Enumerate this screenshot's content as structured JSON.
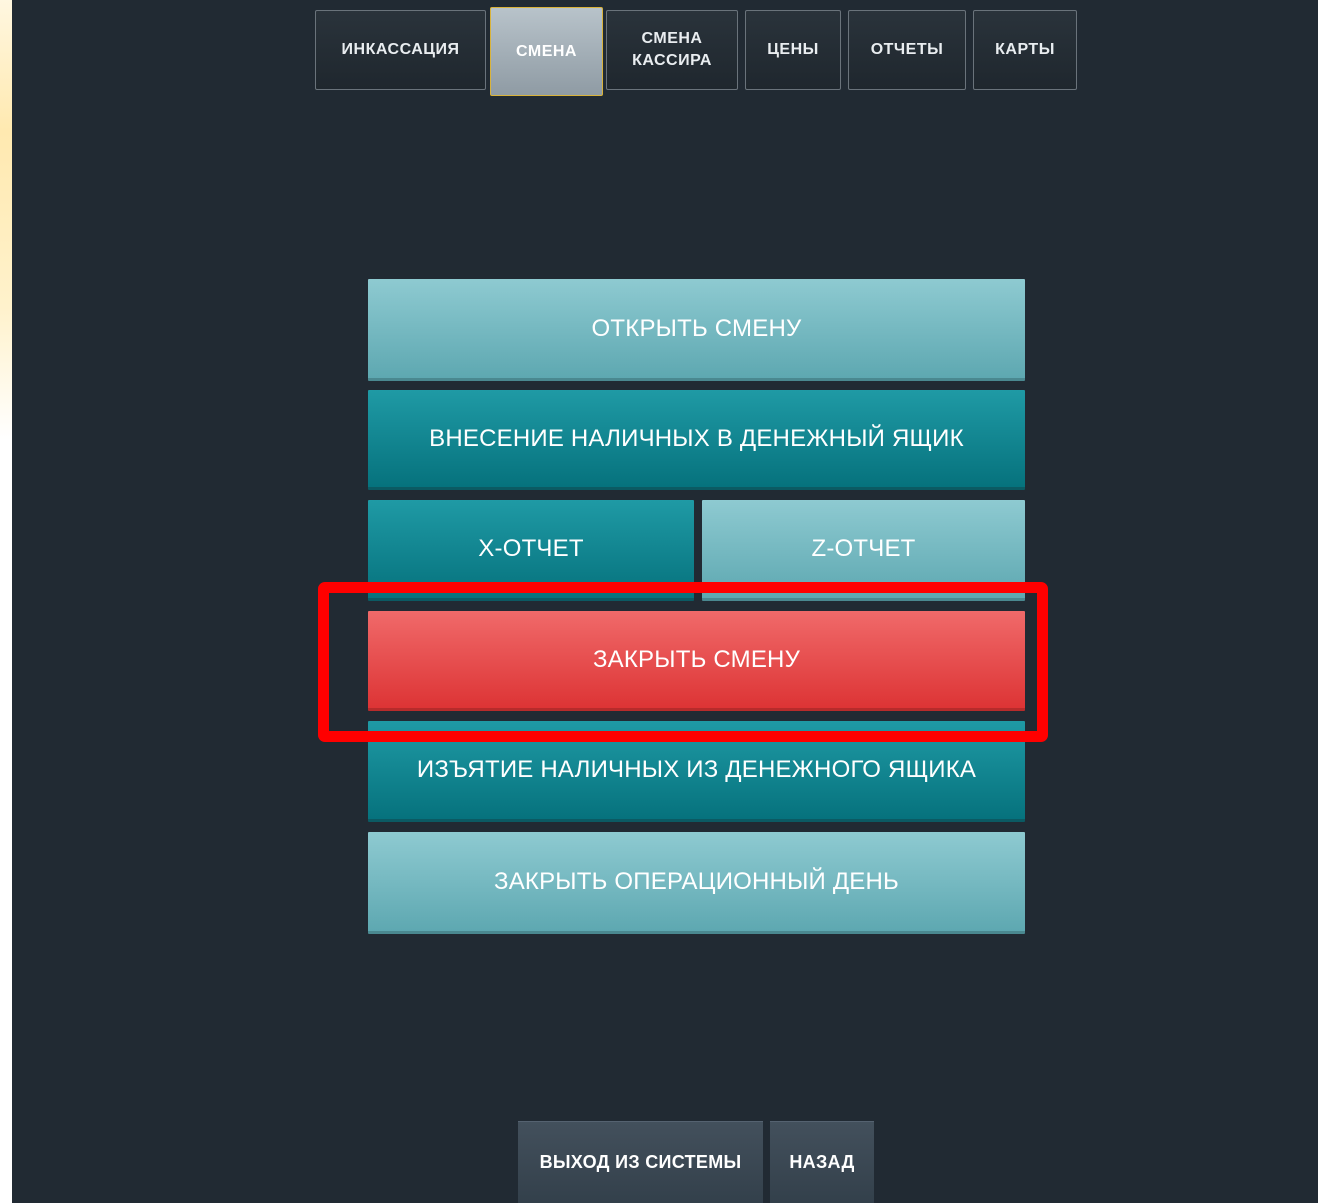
{
  "tabs": [
    {
      "label": "ИНКАССАЦИЯ",
      "active": false
    },
    {
      "label": "СМЕНА",
      "active": true
    },
    {
      "label": "СМЕНА\nКАССИРА",
      "active": false
    },
    {
      "label": "ЦЕНЫ",
      "active": false
    },
    {
      "label": "ОТЧЕТЫ",
      "active": false
    },
    {
      "label": "КАРТЫ",
      "active": false
    }
  ],
  "actions": {
    "open_shift": "ОТКРЫТЬ СМЕНУ",
    "cash_in": "ВНЕСЕНИЕ НАЛИЧНЫХ В ДЕНЕЖНЫЙ ЯЩИК",
    "x_report": "X-ОТЧЕТ",
    "z_report": "Z-ОТЧЕТ",
    "close_shift": "ЗАКРЫТЬ СМЕНУ",
    "cash_out": "ИЗЪЯТИЕ НАЛИЧНЫХ ИЗ ДЕНЕЖНОГО ЯЩИКА",
    "close_day": "ЗАКРЫТЬ ОПЕРАЦИОННЫЙ ДЕНЬ"
  },
  "footer": {
    "logout": "ВЫХОД ИЗ СИСТЕМЫ",
    "back": "НАЗАД"
  },
  "colors": {
    "background": "#212a33",
    "accent_light": "#8ecad1",
    "accent_dark": "#06727d",
    "danger": "#dd3435",
    "highlight_frame": "#ff0000"
  }
}
